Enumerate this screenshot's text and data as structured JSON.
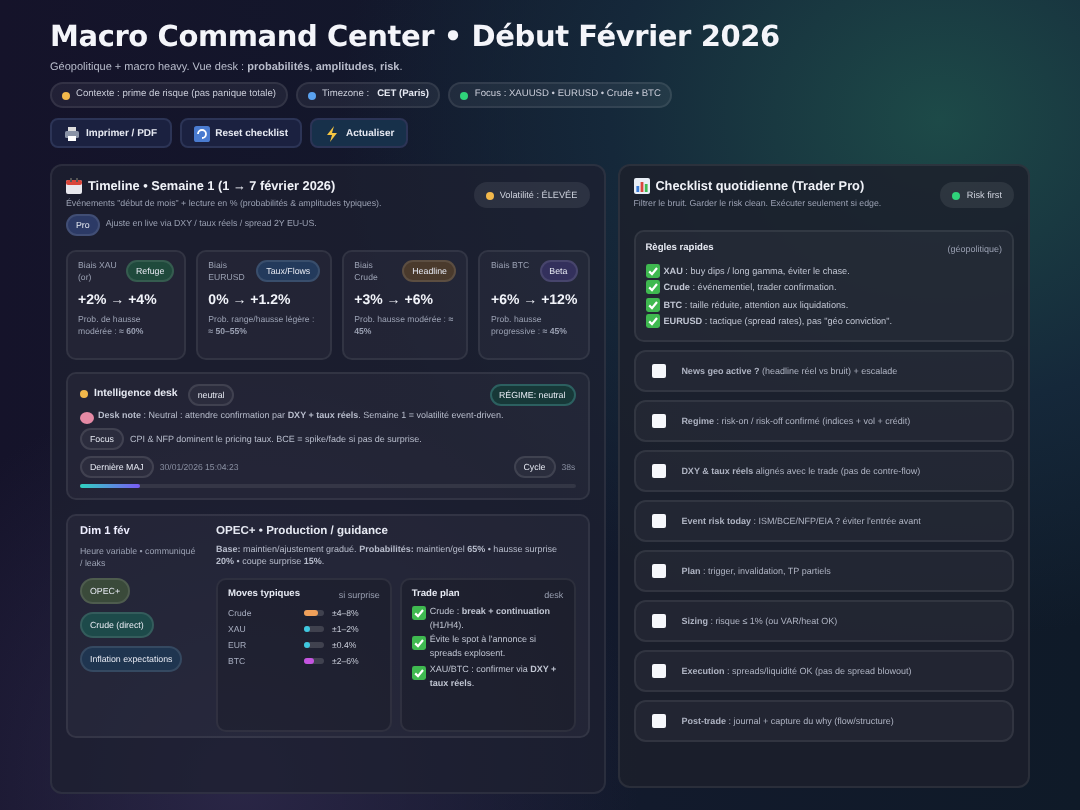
{
  "header": {
    "title": "Macro Command Center • Début Février 2026",
    "subtitle": "Géopolitique + macro heavy. Vue desk : **probabilités**, **amplitudes**, **risk**.",
    "chips": [
      {
        "label": "Contexte : prime de risque (pas panique totale)",
        "color": "#f2b84b"
      },
      {
        "label": "Timezone :",
        "value": "CET (Paris)",
        "color": "#5aa2f0"
      },
      {
        "label": "Focus : XAUUSD • EURUSD • Crude • BTC",
        "color": "#2fd27a"
      }
    ],
    "buttons": [
      {
        "label": "Imprimer / PDF",
        "kind": "print"
      },
      {
        "label": "Reset checklist",
        "kind": "reset"
      },
      {
        "label": "Actualiser",
        "kind": "refresh"
      }
    ]
  },
  "timeline": {
    "title": "Timeline • Semaine 1 (1 → 7 février 2026)",
    "description": "Événements \"début de mois\" + lecture en % (probabilités & amplitudes typiques).",
    "tag": "Pro",
    "note": "Ajuste en live via DXY / taux réels / spread 2Y EU-US.",
    "volatility": {
      "label": "Volatilité : ÉLEVÉE",
      "color": "#f2b84b"
    },
    "bias_cards": [
      {
        "label": "Biais XAU (or)",
        "tag": "Refuge",
        "color": "#1f4a3c",
        "range": "+2% → +4%",
        "prob": "Prob. de hausse modérée : **≈ 60%**"
      },
      {
        "label": "Biais EURUSD",
        "tag": "Taux/Flows",
        "color": "#233a5c",
        "range": "0% → +1.2%",
        "prob": "Prob. range/hausse légère : **≈ 50–55%**"
      },
      {
        "label": "Biais Crude",
        "tag": "Headline",
        "color": "#4a3a2c",
        "range": "+3% → +6%",
        "prob": "Prob. hausse modérée : **≈ 45%**"
      },
      {
        "label": "Biais BTC",
        "tag": "Beta",
        "color": "#33305c",
        "range": "+6% → +12%",
        "prob": "Prob. hausse progressive : **≈ 45%**"
      }
    ]
  },
  "intelligence": {
    "title": "Intelligence desk",
    "color": "#f2b84b",
    "state": "neutral",
    "regime": "RÉGIME: neutral",
    "note": "**Desk note** : Neutral : attendre confirmation par **DXY + taux réels**. Semaine 1 = volatilité event-driven.",
    "focus_tag": "Focus",
    "focus": "CPI & NFP dominent le pricing taux. BCE = spike/fade si pas de surprise.",
    "update_label": "Dernière MAJ",
    "update_time": "30/01/2026 15:04:23",
    "cycle_label": "Cycle",
    "cycle_value": "38s",
    "level": 0.12
  },
  "event": {
    "date": "Dim 1 fév",
    "time_note": "Heure variable • communiqué / leaks",
    "tags": [
      {
        "label": "OPEC+",
        "color": "#3a4a3a"
      },
      {
        "label": "Crude (direct)",
        "color": "#1d4a4a"
      },
      {
        "label": "Inflation expectations",
        "color": "#1f3550"
      }
    ],
    "title": "OPEC+ • Production / guidance",
    "base": "**Base:** maintien/ajustement gradué. **Probabilités:** maintien/gel **65%** • hausse surprise **20%** • coupe surprise **15%**.",
    "moves": {
      "title": "Moves typiques",
      "note": "si surprise",
      "rows": [
        {
          "asset": "Crude",
          "level": 0.65,
          "color": "#f0a05a",
          "value": "±4–8%"
        },
        {
          "asset": "XAU",
          "level": 0.3,
          "color": "#3ec8e0",
          "value": "±1–2%"
        },
        {
          "asset": "EUR",
          "level": 0.3,
          "color": "#3ec8e0",
          "value": "±0.4%"
        },
        {
          "asset": "BTC",
          "level": 0.45,
          "color": "#c454e0",
          "value": "±2–6%"
        }
      ]
    },
    "plan": {
      "title": "Trade plan",
      "note": "desk",
      "items": [
        "Crude : **break + continuation** (H1/H4).",
        "Évite le spot à l'annonce si spreads explosent.",
        "XAU/BTC : confirmer via **DXY + taux réels**."
      ]
    }
  },
  "checklist": {
    "title": "Checklist quotidienne (Trader Pro)",
    "description": "Filtrer le bruit. Garder le risk clean. Exécuter seulement si edge.",
    "badge": {
      "label": "Risk first",
      "color": "#2fd27a"
    },
    "rules": {
      "title": "Règles rapides",
      "note": "(géopolitique)",
      "items": [
        "**XAU** : buy dips / long gamma, éviter le chase.",
        "**Crude** : événementiel, trader confirmation.",
        "**BTC** : taille réduite, attention aux liquidations.",
        "**EURUSD** : tactique (spread rates), pas \"géo conviction\"."
      ]
    },
    "items": [
      {
        "text": "**News geo active ?** (headline réel vs bruit) + escalade",
        "checked": false
      },
      {
        "text": "**Regime** : risk-on / risk-off confirmé (indices + vol + crédit)",
        "checked": false
      },
      {
        "text": "**DXY & taux réels** alignés avec le trade (pas de contre-flow)",
        "checked": false
      },
      {
        "text": "**Event risk today** : ISM/BCE/NFP/EIA ? éviter l'entrée avant",
        "checked": false
      },
      {
        "text": "**Plan** : trigger, invalidation, TP partiels",
        "checked": false
      },
      {
        "text": "**Sizing** : risque ≤ 1% (ou VAR/heat OK)",
        "checked": false
      },
      {
        "text": "**Execution** : spreads/liquidité OK (pas de spread blowout)",
        "checked": false
      },
      {
        "text": "**Post-trade** : journal + capture du why (flow/structure)",
        "checked": false
      }
    ]
  }
}
